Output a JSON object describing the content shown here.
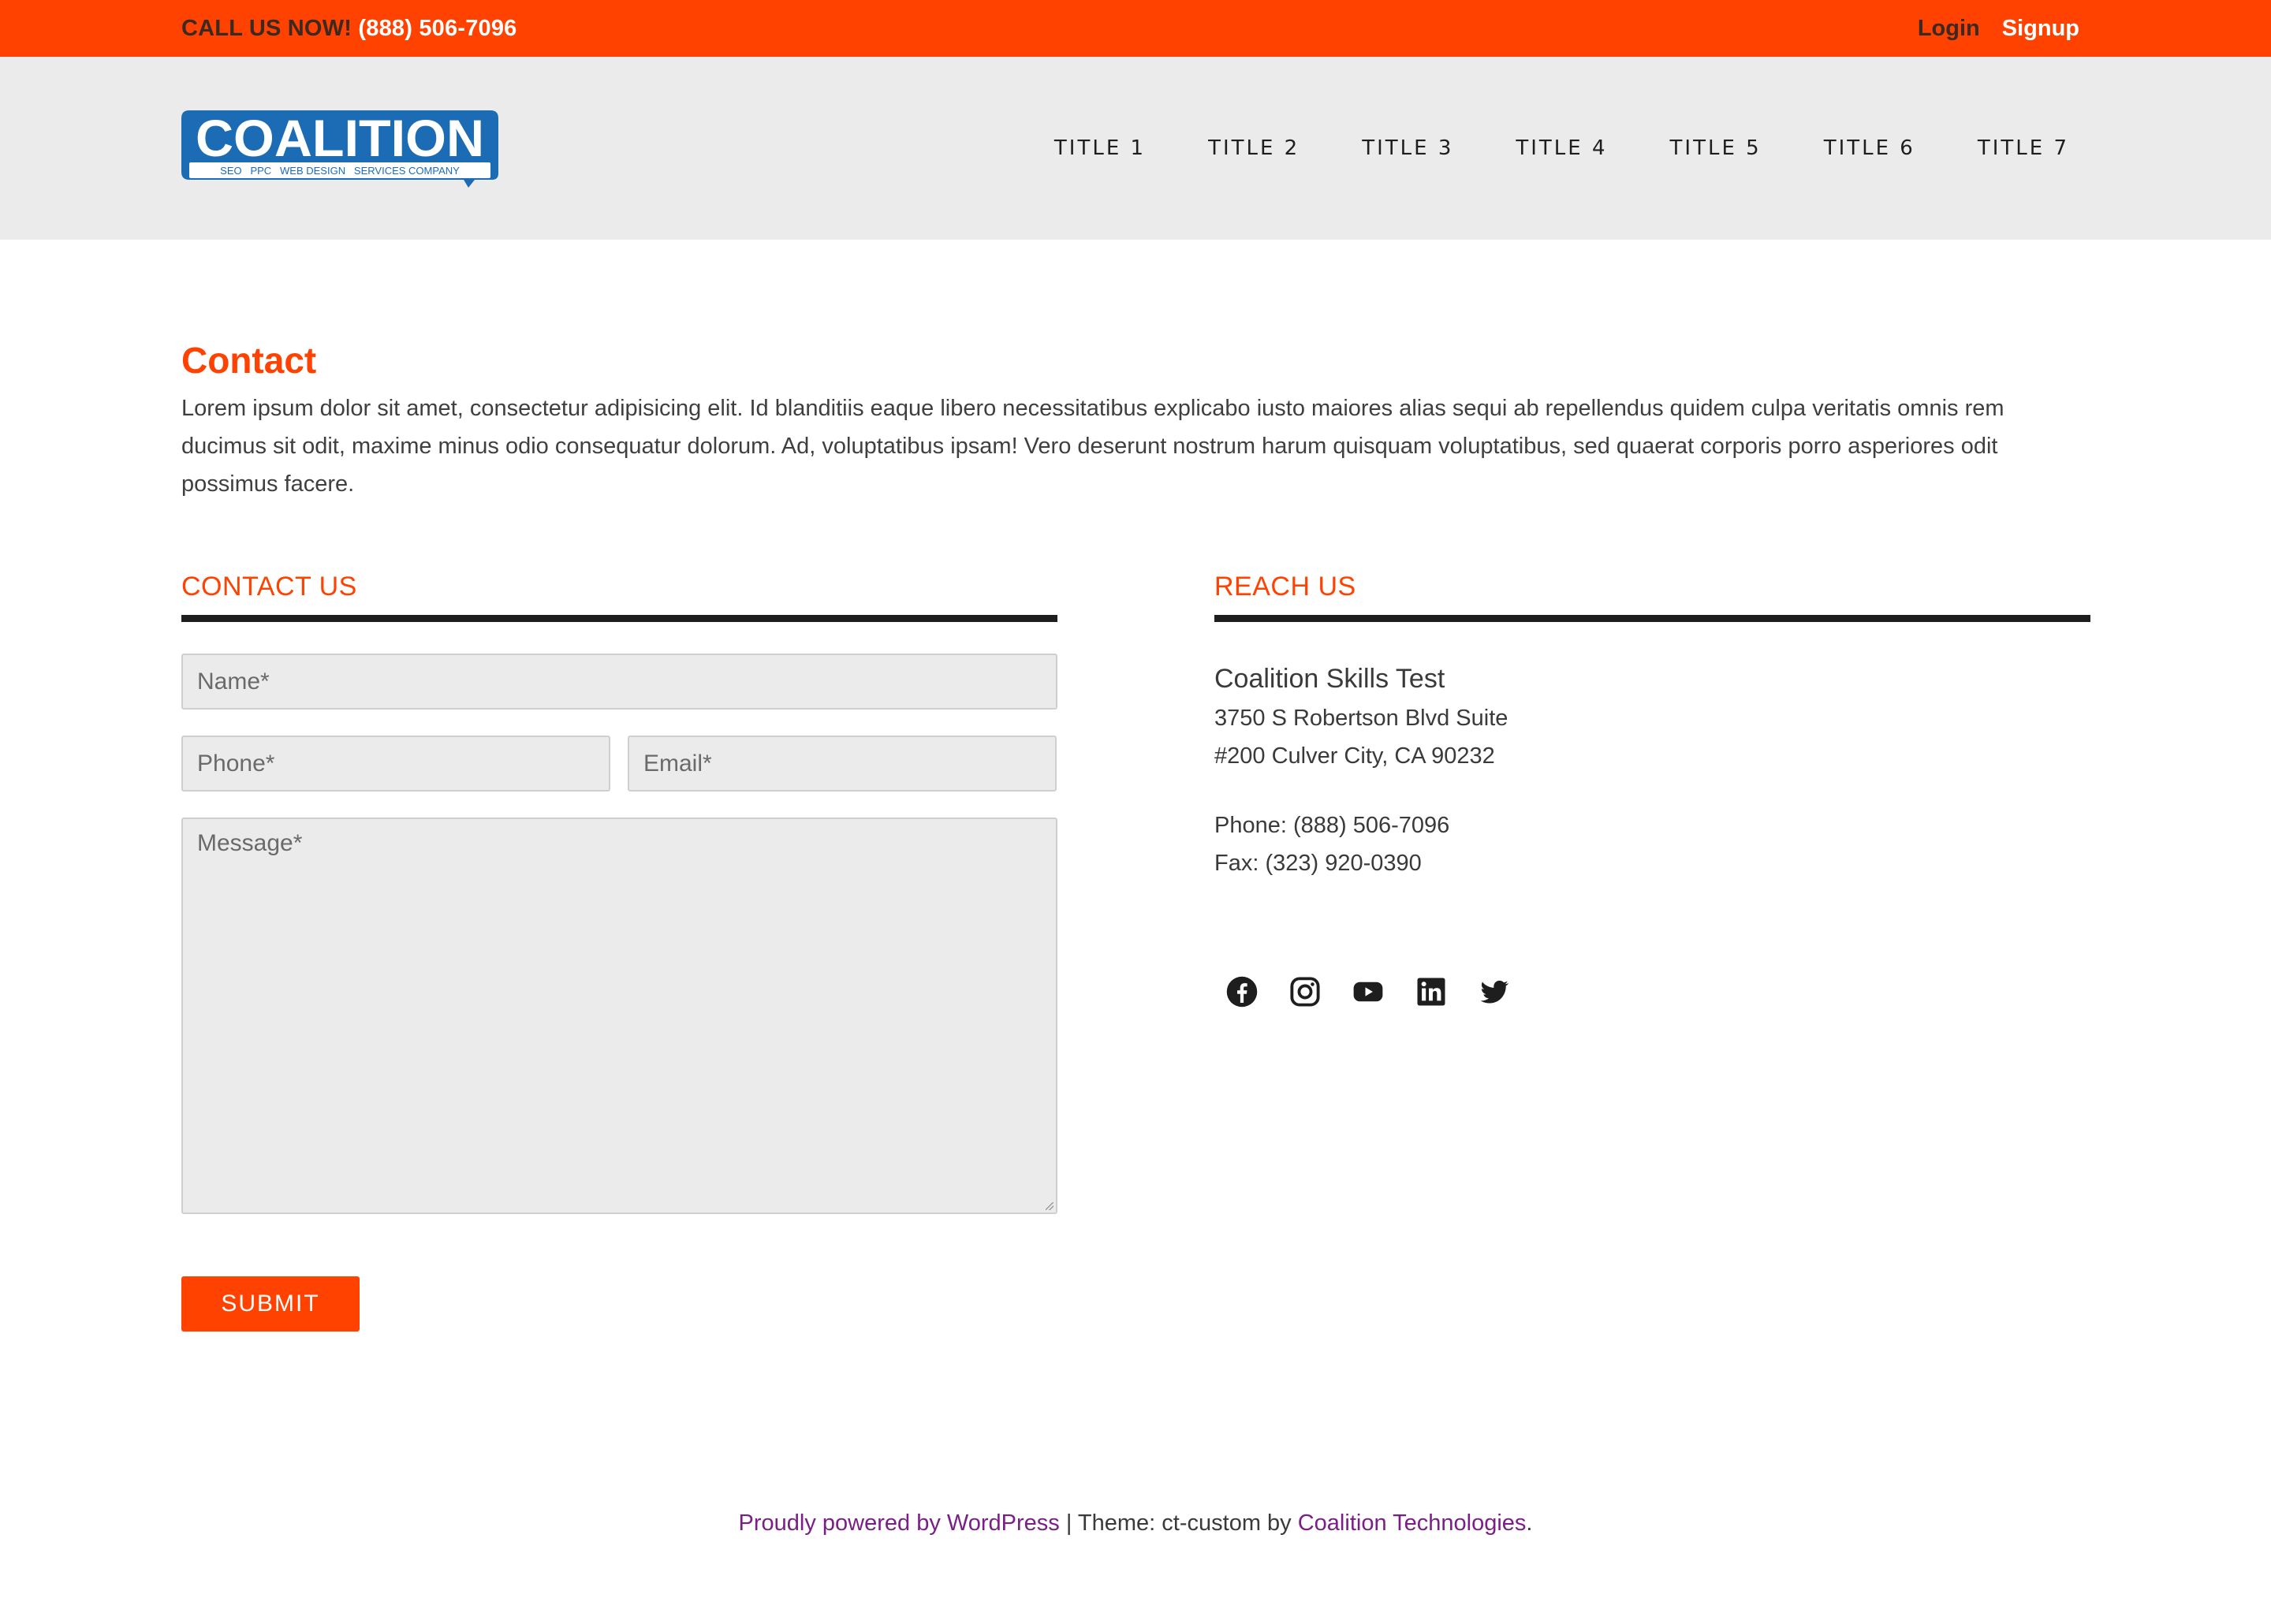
{
  "topbar": {
    "call_label": "CALL US NOW!",
    "phone": "(888) 506-7096",
    "login": "Login",
    "signup": "Signup",
    "color": "#ff4200"
  },
  "header": {
    "logo": {
      "text": "COALITION",
      "tagline": "SEO   PPC   WEB DESIGN   SERVICES COMPANY",
      "color": "#1b6cb5"
    },
    "nav": [
      "TITLE 1",
      "TITLE 2",
      "TITLE 3",
      "TITLE 4",
      "TITLE 5",
      "TITLE 6",
      "TITLE 7"
    ]
  },
  "main": {
    "title": "Contact",
    "intro": "Lorem ipsum dolor sit amet, consectetur adipisicing elit. Id blanditiis eaque libero necessitatibus explicabo iusto maiores alias sequi ab repellendus quidem culpa veritatis omnis rem ducimus sit odit, maxime minus odio consequatur dolorum. Ad, voluptatibus ipsam! Vero deserunt nostrum harum quisquam voluptatibus, sed quaerat corporis porro asperiores odit possimus facere."
  },
  "contact_form": {
    "heading": "CONTACT US",
    "name_placeholder": "Name*",
    "phone_placeholder": "Phone*",
    "email_placeholder": "Email*",
    "message_placeholder": "Message*",
    "submit_label": "SUBMIT"
  },
  "reach": {
    "heading": "REACH US",
    "org": "Coalition Skills Test",
    "address_line1": "3750 S Robertson Blvd Suite",
    "address_line2": "#200 Culver City, CA 90232",
    "phone": "Phone: (888) 506-7096",
    "fax": "Fax: (323) 920-0390",
    "social_icons": [
      "facebook-icon",
      "instagram-icon",
      "youtube-icon",
      "linkedin-icon",
      "twitter-icon"
    ]
  },
  "footer": {
    "powered": "Proudly powered by WordPress",
    "separator": " | Theme: ct-custom by ",
    "company": "Coalition Technologies",
    "end": "."
  }
}
